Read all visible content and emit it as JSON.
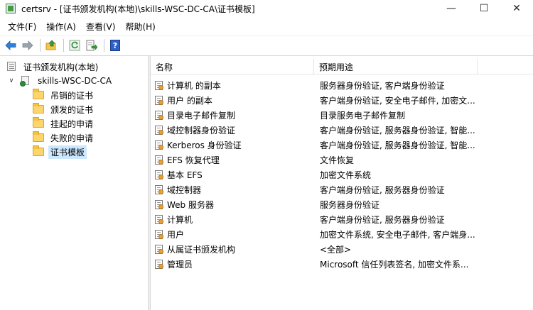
{
  "window": {
    "title": "certsrv - [证书颁发机构(本地)\\skills-WSC-DC-CA\\证书模板]",
    "controls": {
      "minimize": "—",
      "maximize": "☐",
      "close": "✕"
    }
  },
  "menu": [
    "文件(F)",
    "操作(A)",
    "查看(V)",
    "帮助(H)"
  ],
  "toolbar": {
    "buttons": [
      "back-arrow-icon",
      "forward-arrow-icon",
      "up-folder-icon",
      "refresh-icon",
      "export-list-icon",
      "help-icon"
    ],
    "help_glyph": "?"
  },
  "tree": {
    "root": {
      "label": "证书颁发机构(本地)",
      "icon": "ca-root-icon"
    },
    "ca": {
      "label": "skills-WSC-DC-CA",
      "icon": "ca-server-icon",
      "toggle": "∨"
    },
    "children": [
      {
        "label": "吊销的证书"
      },
      {
        "label": "颁发的证书"
      },
      {
        "label": "挂起的申请"
      },
      {
        "label": "失败的申请"
      },
      {
        "label": "证书模板",
        "selected": true
      }
    ]
  },
  "list": {
    "columns": {
      "name": "名称",
      "purpose": "预期用途"
    },
    "rows": [
      {
        "name": "计算机 的副本",
        "purpose": "服务器身份验证, 客户端身份验证"
      },
      {
        "name": "用户 的副本",
        "purpose": "客户端身份验证, 安全电子邮件, 加密文..."
      },
      {
        "name": "目录电子邮件复制",
        "purpose": "目录服务电子邮件复制"
      },
      {
        "name": "域控制器身份验证",
        "purpose": "客户端身份验证, 服务器身份验证, 智能..."
      },
      {
        "name": "Kerberos 身份验证",
        "purpose": "客户端身份验证, 服务器身份验证, 智能..."
      },
      {
        "name": "EFS 恢复代理",
        "purpose": "文件恢复"
      },
      {
        "name": "基本 EFS",
        "purpose": "加密文件系统"
      },
      {
        "name": "域控制器",
        "purpose": "客户端身份验证, 服务器身份验证"
      },
      {
        "name": "Web 服务器",
        "purpose": "服务器身份验证"
      },
      {
        "name": "计算机",
        "purpose": "客户端身份验证, 服务器身份验证"
      },
      {
        "name": "用户",
        "purpose": "加密文件系统, 安全电子邮件, 客户端身..."
      },
      {
        "name": "从属证书颁发机构",
        "purpose": "<全部>"
      },
      {
        "name": "管理员",
        "purpose": "Microsoft 信任列表签名, 加密文件系..."
      }
    ]
  }
}
